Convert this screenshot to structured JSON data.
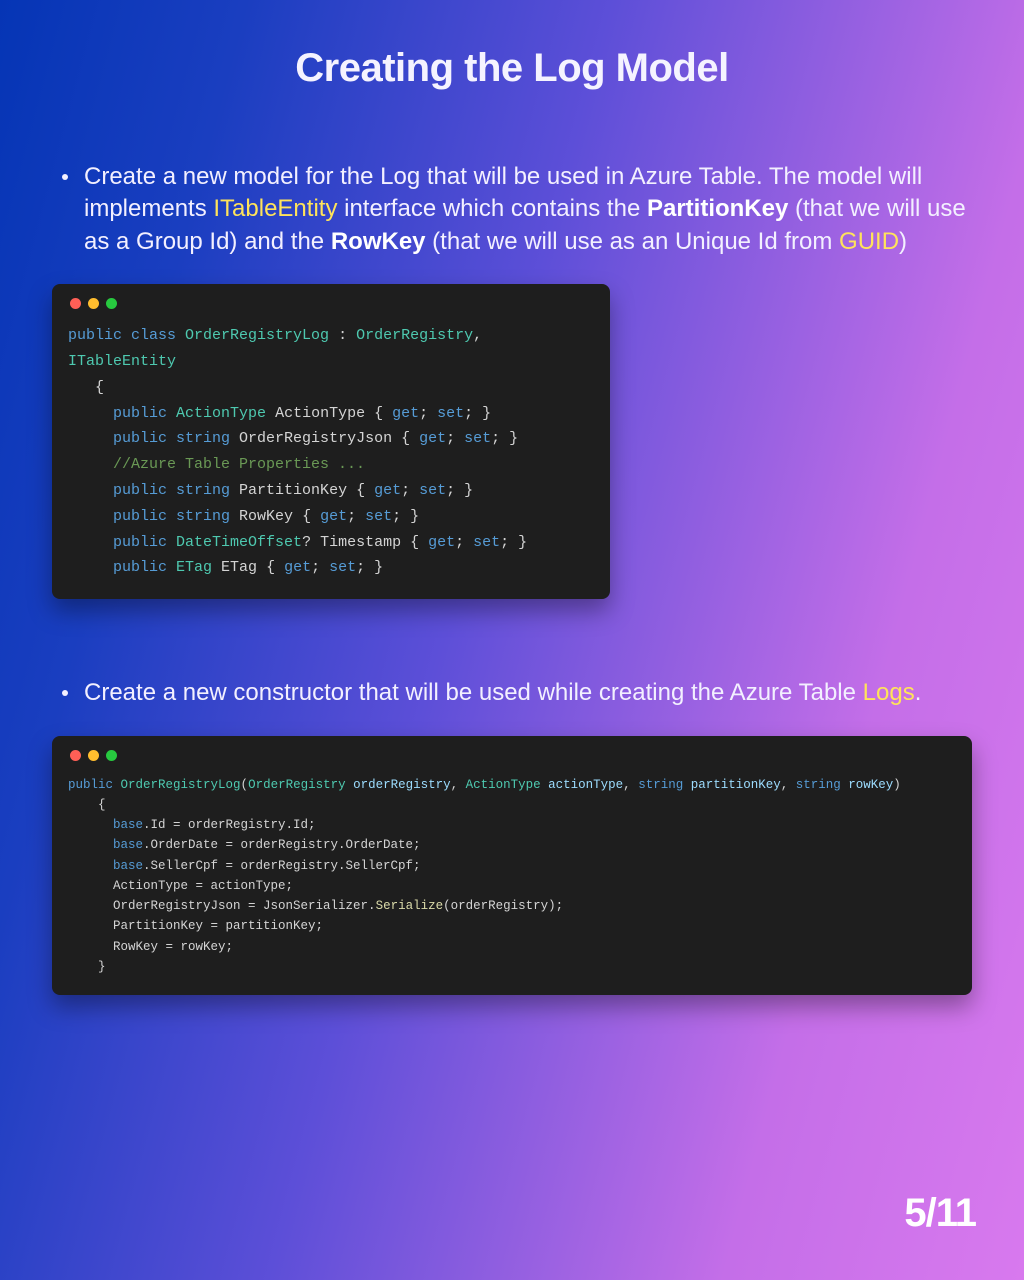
{
  "title": "Creating the Log Model",
  "bullet1": {
    "t1": "Create a new model for the Log that will be used in Azure Table. The model will implements ",
    "t2": "ITableEntity",
    "t3": " interface which contains the ",
    "t4": "PartitionKey",
    "t5": " (that we will use as a Group Id) and the ",
    "t6": "RowKey",
    "t7": " (that we will use as an Unique Id from ",
    "t8": "GUID",
    "t9": ")"
  },
  "bullet2": {
    "t1": "Create a new constructor that will be used while creating the Azure Table ",
    "t2": "Logs",
    "t3": "."
  },
  "code1": {
    "l1a": "public",
    "l1b": " class",
    "l1c": " OrderRegistryLog",
    "l1d": " :",
    "l1e": " OrderRegistry",
    "l1f": ",",
    "l2a": "ITableEntity",
    "l3": "   {",
    "l4a": "     public",
    "l4b": " ActionType",
    "l4c": " ActionType",
    "l4d": " {",
    "l4e": " get",
    "l4f": ";",
    "l4g": " set",
    "l4h": "; }",
    "l5a": "     public",
    "l5b": " string",
    "l5c": " OrderRegistryJson",
    "l5d": " {",
    "l5e": " get",
    "l5f": ";",
    "l5g": " set",
    "l5h": "; }",
    "l6": "     //Azure Table Properties ...",
    "l7a": "     public",
    "l7b": " string",
    "l7c": " PartitionKey",
    "l7d": " {",
    "l7e": " get",
    "l7f": ";",
    "l7g": " set",
    "l7h": "; }",
    "l8a": "     public",
    "l8b": " string",
    "l8c": " RowKey",
    "l8d": " {",
    "l8e": " get",
    "l8f": ";",
    "l8g": " set",
    "l8h": "; }",
    "l9a": "     public",
    "l9b": " DateTimeOffset",
    "l9c": "?",
    "l9d": " Timestamp",
    "l9e": " {",
    "l9f": " get",
    "l9g": ";",
    "l9h": " set",
    "l9i": "; }",
    "l10a": "     public",
    "l10b": " ETag",
    "l10c": " ETag",
    "l10d": " {",
    "l10e": " get",
    "l10f": ";",
    "l10g": " set",
    "l10h": "; }"
  },
  "code2": {
    "l1a": "public",
    "l1b": " OrderRegistryLog",
    "l1c": "(",
    "l1d": "OrderRegistry",
    "l1e": " orderRegistry",
    "l1f": ",",
    "l1g": " ActionType",
    "l1h": " actionType",
    "l1i": ",",
    "l1j": " string",
    "l1k": " partitionKey",
    "l1l": ",",
    "l1m": " string",
    "l1n": " rowKey",
    "l1o": ")",
    "l2": "    {",
    "l3a": "      base",
    "l3b": ".Id = orderRegistry.Id;",
    "l4a": "      base",
    "l4b": ".OrderDate = orderRegistry.OrderDate;",
    "l5a": "      base",
    "l5b": ".SellerCpf = orderRegistry.SellerCpf;",
    "l6": "      ActionType = actionType;",
    "l7a": "      OrderRegistryJson = JsonSerializer.",
    "l7b": "Serialize",
    "l7c": "(orderRegistry);",
    "l8": "      PartitionKey = partitionKey;",
    "l9": "      RowKey = rowKey;",
    "l10": "    }"
  },
  "page_number": "5/11"
}
